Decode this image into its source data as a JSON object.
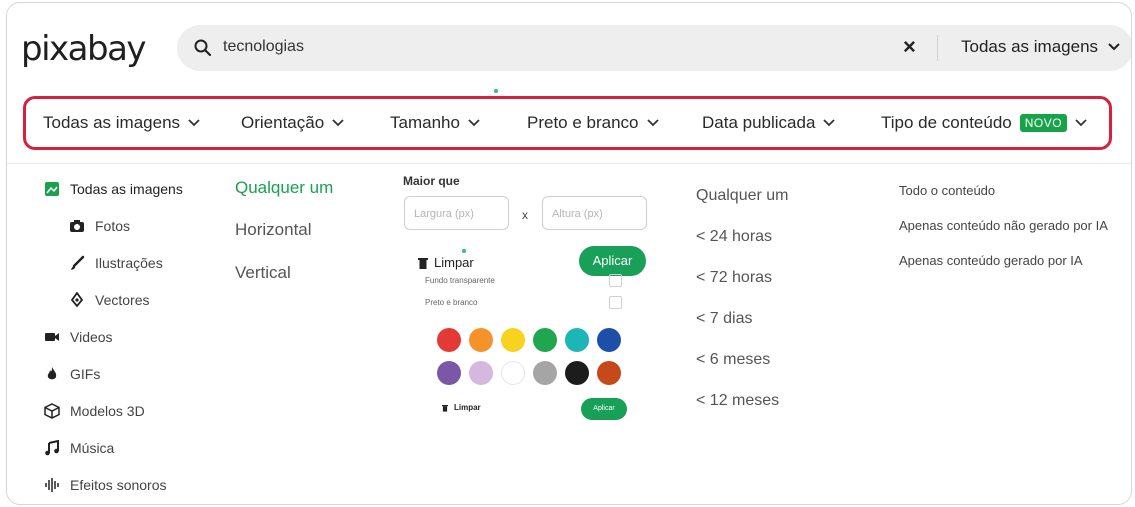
{
  "logo": "pixabay",
  "search": {
    "query": "tecnologias",
    "clear": "×",
    "type_label": "Todas as imagens"
  },
  "filters": [
    {
      "label": "Todas as imagens"
    },
    {
      "label": "Orientação"
    },
    {
      "label": "Tamanho"
    },
    {
      "label": "Preto e branco"
    },
    {
      "label": "Data publicada"
    },
    {
      "label": "Tipo de conteúdo",
      "badge": "NOVO"
    }
  ],
  "media_types": [
    {
      "label": "Todas as imagens",
      "icon": "image-icon",
      "active": true
    },
    {
      "label": "Fotos",
      "icon": "camera-icon"
    },
    {
      "label": "Ilustrações",
      "icon": "brush-icon"
    },
    {
      "label": "Vectores",
      "icon": "pen-tool-icon"
    },
    {
      "label": "Videos",
      "icon": "video-icon"
    },
    {
      "label": "GIFs",
      "icon": "flame-icon"
    },
    {
      "label": "Modelos 3D",
      "icon": "cube-icon"
    },
    {
      "label": "Música",
      "icon": "music-icon"
    },
    {
      "label": "Efeitos sonoros",
      "icon": "soundwave-icon"
    }
  ],
  "orientation": {
    "options": [
      "Qualquer um",
      "Horizontal",
      "Vertical"
    ],
    "selected": "Qualquer um"
  },
  "size": {
    "label": "Maior que",
    "width_placeholder": "Largura (px)",
    "height_placeholder": "Altura (px)",
    "x": "x",
    "clear": "Limpar",
    "apply": "Aplicar"
  },
  "color": {
    "options": [
      "Fundo transparente",
      "Preto e branco"
    ],
    "swatches": [
      "#e53935",
      "#f5922a",
      "#f7d21e",
      "#1fa64e",
      "#1cb6b6",
      "#1e4fa8",
      "#7b58a6",
      "#d6b7e0",
      "#ffffff",
      "#a5a5a5",
      "#1c1c1c",
      "#c6491b"
    ],
    "clear": "Limpar",
    "apply": "Aplicar"
  },
  "date": {
    "options": [
      "Qualquer um",
      "< 24 horas",
      "< 72 horas",
      "< 7 dias",
      "< 6 meses",
      "< 12 meses"
    ],
    "selected": "Qualquer um"
  },
  "content_type": {
    "options": [
      "Todo o conteúdo",
      "Apenas conteúdo não gerado por IA",
      "Apenas conteúdo gerado por IA"
    ],
    "selected": "Todo o conteúdo"
  },
  "colors": {
    "accent": "#1aa14e",
    "highlight_border": "#d7203e",
    "badge": "#16a34a"
  }
}
